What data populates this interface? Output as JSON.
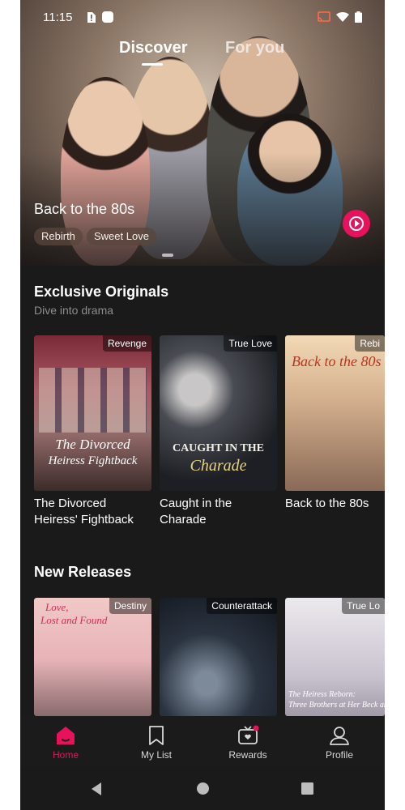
{
  "status_bar": {
    "time": "11:15"
  },
  "top_tabs": [
    {
      "label": "Discover",
      "active": true
    },
    {
      "label": "For you",
      "active": false
    }
  ],
  "hero": {
    "title": "Back to the 80s",
    "tags": [
      "Rebirth",
      "Sweet Love"
    ]
  },
  "exclusive": {
    "title": "Exclusive Originals",
    "subtitle": "Dive into drama",
    "items": [
      {
        "tag": "Revenge",
        "title_line1": "The Divorced",
        "title_line2": "Heiress' Fightback",
        "poster_text_1": "The Divorced",
        "poster_text_2": "Heiress Fightback"
      },
      {
        "tag": "True Love",
        "title_line1": "Caught in the",
        "title_line2": "Charade",
        "poster_text_1": "CAUGHT IN THE",
        "poster_text_2": "Charade"
      },
      {
        "tag": "Rebi",
        "title_line1": "Back to the 80s",
        "title_line2": "",
        "poster_text_1": "Back to the 80s",
        "poster_text_2": ""
      }
    ]
  },
  "new_releases": {
    "title": "New Releases",
    "items": [
      {
        "tag": "Destiny",
        "poster_text_1": "Love,",
        "poster_text_2": "Lost and Found"
      },
      {
        "tag": "Counterattack",
        "poster_text_1": "",
        "poster_text_2": ""
      },
      {
        "tag": "True Lo",
        "poster_text_1": "The Heiress Reborn:",
        "poster_text_2": "Three Brothers at Her Beck and"
      }
    ]
  },
  "bottom_nav": [
    {
      "label": "Home",
      "icon": "home-icon",
      "active": true
    },
    {
      "label": "My List",
      "icon": "bookmark-icon",
      "active": false
    },
    {
      "label": "Rewards",
      "icon": "rewards-icon",
      "active": false
    },
    {
      "label": "Profile",
      "icon": "profile-icon",
      "active": false
    }
  ],
  "colors": {
    "accent": "#e8125c",
    "background": "#1a1a1a"
  }
}
